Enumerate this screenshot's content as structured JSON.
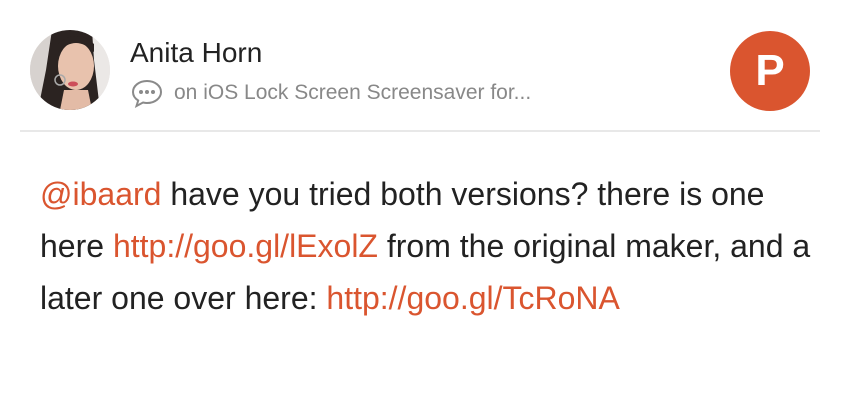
{
  "comment": {
    "author_name": "Anita Horn",
    "context_text": "on iOS Lock Screen Screensaver for...",
    "mention": "@ibaard",
    "text_1": " have you tried both versions? there is one here ",
    "link_1": "http://goo.gl/lExolZ",
    "text_2": " from the original maker, and a later one over here: ",
    "link_2": "http://goo.gl/TcRoNA"
  },
  "icons": {
    "avatar": "user-avatar-photo",
    "context": "speech-bubble-icon",
    "brand": "product-hunt-logo"
  },
  "brand": {
    "letter": "P"
  },
  "colors": {
    "accent": "#da552f",
    "text": "#222222",
    "muted": "#888888",
    "divider": "#e8e8e8"
  }
}
